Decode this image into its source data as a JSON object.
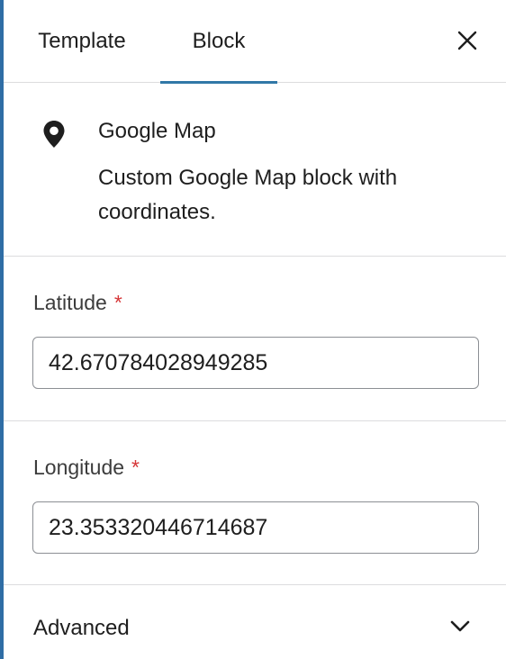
{
  "tabs": [
    {
      "label": "Template",
      "active": false
    },
    {
      "label": "Block",
      "active": true
    }
  ],
  "block": {
    "icon": "map-pin-icon",
    "title": "Google Map",
    "description": "Custom Google Map block with coordinates."
  },
  "fields": {
    "latitude": {
      "label": "Latitude",
      "required_mark": "*",
      "value": "42.670784028949285"
    },
    "longitude": {
      "label": "Longitude",
      "required_mark": "*",
      "value": "23.353320446714687"
    }
  },
  "advanced": {
    "label": "Advanced",
    "icon": "chevron-down-icon",
    "expanded": false
  },
  "colors": {
    "accent": "#3178a7",
    "required": "#d63638",
    "border": "#8c8f94",
    "divider": "#dcdcde"
  }
}
